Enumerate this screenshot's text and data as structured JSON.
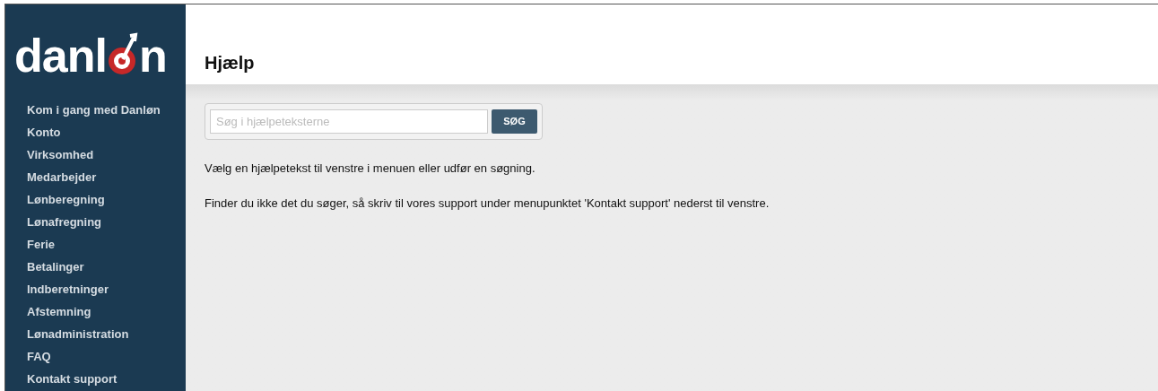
{
  "logo": {
    "before": "danl",
    "after": "n"
  },
  "sidebar": {
    "items": [
      "Kom i gang med Danløn",
      "Konto",
      "Virksomhed",
      "Medarbejder",
      "Lønberegning",
      "Lønafregning",
      "Ferie",
      "Betalinger",
      "Indberetninger",
      "Afstemning",
      "Lønadministration",
      "FAQ",
      "Kontakt support"
    ]
  },
  "page_title": "Hjælp",
  "search": {
    "placeholder": "Søg i hjælpeteksterne",
    "button": "SØG"
  },
  "paragraphs": [
    "Vælg en hjælpetekst til venstre i menuen eller udfør en søgning.",
    "Finder du ikke det du søger, så skriv til vores support under menupunktet 'Kontakt support' nederst til venstre."
  ]
}
